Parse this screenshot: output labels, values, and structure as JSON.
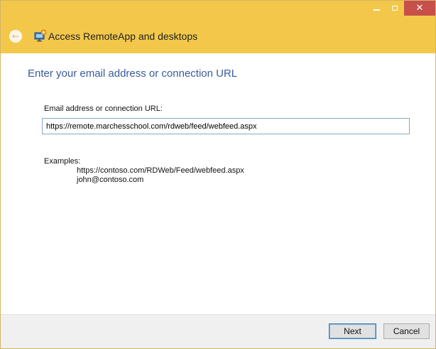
{
  "window": {
    "title": "",
    "caption_buttons": {
      "minimize": "minimize-icon",
      "maximize": "maximize-icon",
      "close": "✕"
    }
  },
  "nav": {
    "back_icon": "←",
    "app_title": "Access RemoteApp and desktops"
  },
  "main": {
    "heading": "Enter your email address or connection URL",
    "field_label": "Email address or connection URL:",
    "field_value": "https://remote.marchesschool.com/rdweb/feed/webfeed.aspx",
    "examples_label": "Examples:",
    "examples": [
      "https://contoso.com/RDWeb/Feed/webfeed.aspx",
      "john@contoso.com"
    ]
  },
  "footer": {
    "next_label": "Next",
    "cancel_label": "Cancel"
  },
  "colors": {
    "chrome": "#f3c84a",
    "close_button": "#c7504a",
    "heading": "#3a5a9c"
  }
}
